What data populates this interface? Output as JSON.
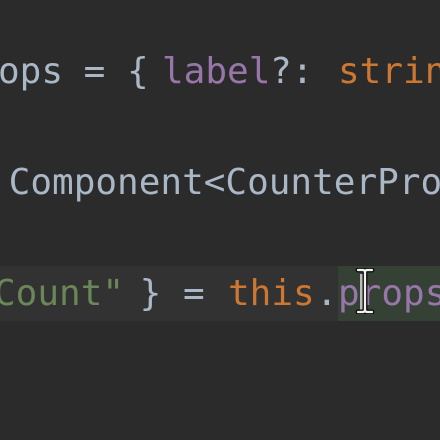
{
  "editor": {
    "lines": [
      {
        "tokens": [
          {
            "text": "ops",
            "role": "type-name",
            "color": "#a9b7c6"
          },
          {
            "text": " = { ",
            "role": "punctuation",
            "color": "#a9b7c6"
          },
          {
            "text": "label",
            "role": "property",
            "color": "#9876aa"
          },
          {
            "text": "?: ",
            "role": "punctuation",
            "color": "#a9b7c6"
          },
          {
            "text": "strin",
            "role": "type-keyword",
            "color": "#cc7832"
          }
        ]
      },
      {
        "tokens": [
          {
            "text": " Component<CounterPro",
            "role": "class-name",
            "color": "#a9b7c6"
          }
        ]
      },
      {
        "tokens": [
          {
            "text": "Count\"",
            "role": "string",
            "color": "#6a8759"
          },
          {
            "text": " } = ",
            "role": "punctuation",
            "color": "#a9b7c6"
          },
          {
            "text": "this",
            "role": "keyword",
            "color": "#cc7832"
          },
          {
            "text": ".",
            "role": "punctuation",
            "color": "#a9b7c6"
          },
          {
            "text": "props",
            "role": "property",
            "color": "#9876aa"
          }
        ]
      }
    ],
    "colors": {
      "background": "#2b2b2b",
      "current_line": "#323232",
      "identifier_highlight": "#344134",
      "caret": "#bbbbbb"
    },
    "cursor": {
      "type": "text-i-beam"
    }
  }
}
